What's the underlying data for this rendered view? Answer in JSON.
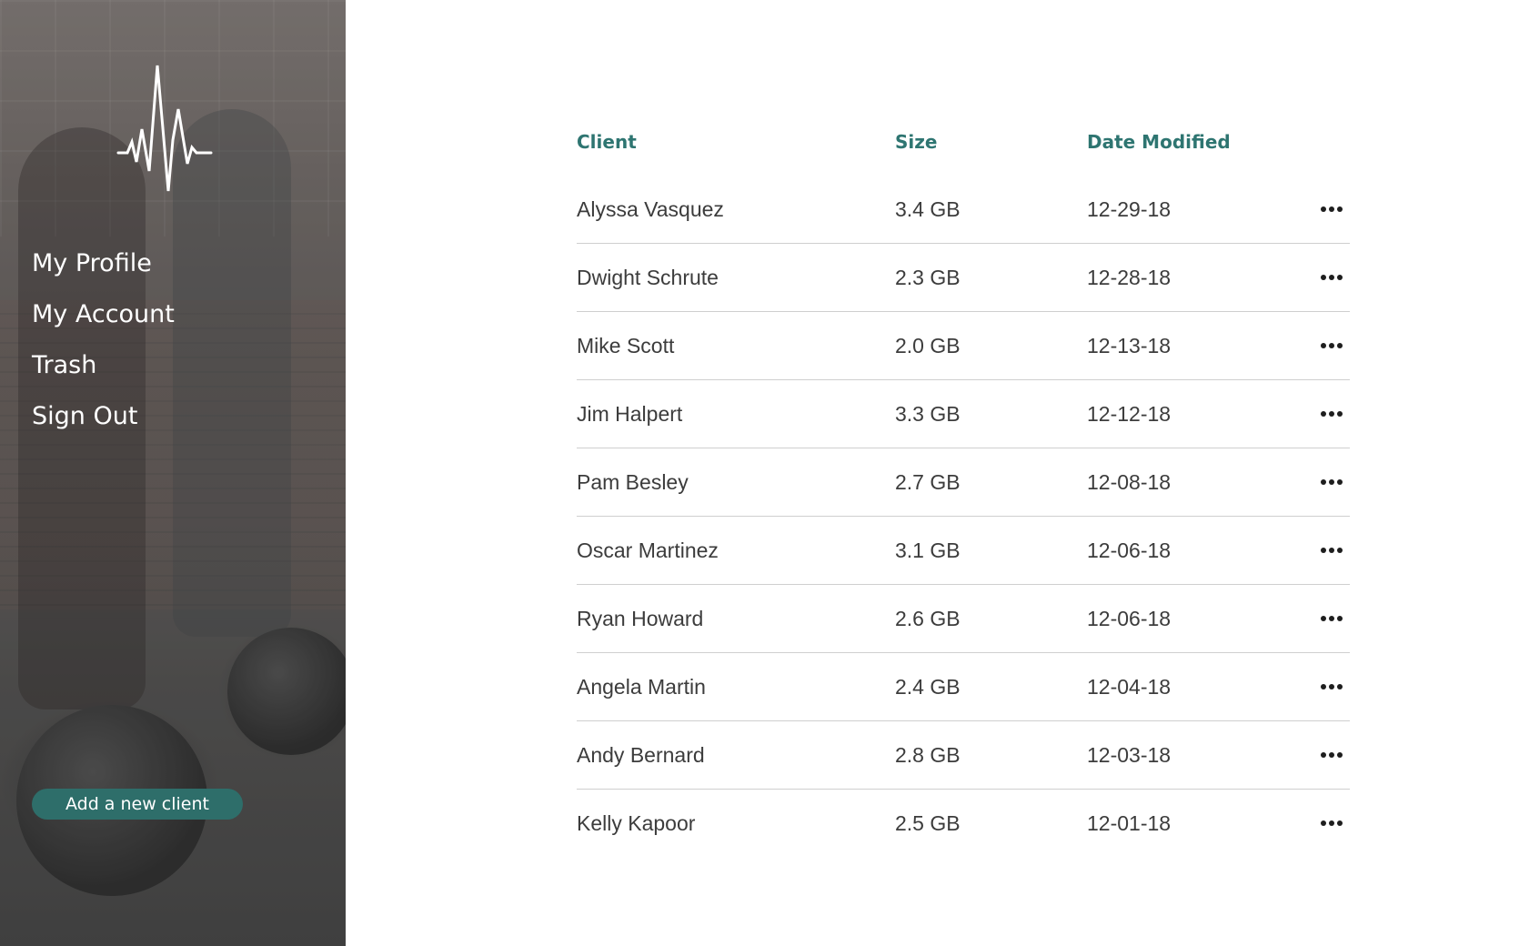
{
  "sidebar": {
    "logo_icon": "heartbeat-pulse-icon",
    "nav": [
      {
        "label": "My Profile"
      },
      {
        "label": "My Account"
      },
      {
        "label": "Trash"
      },
      {
        "label": "Sign Out"
      }
    ],
    "add_client_label": "Add a new client"
  },
  "table": {
    "headers": {
      "client": "Client",
      "size": "Size",
      "date": "Date Modified"
    },
    "row_menu_icon": "more-horizontal-icon",
    "rows": [
      {
        "client": "Alyssa Vasquez",
        "size": "3.4 GB",
        "date": "12-29-18"
      },
      {
        "client": "Dwight Schrute",
        "size": "2.3 GB",
        "date": "12-28-18"
      },
      {
        "client": "Mike Scott",
        "size": "2.0 GB",
        "date": "12-13-18"
      },
      {
        "client": "Jim Halpert",
        "size": "3.3 GB",
        "date": "12-12-18"
      },
      {
        "client": "Pam Besley",
        "size": "2.7 GB",
        "date": "12-08-18"
      },
      {
        "client": "Oscar Martinez",
        "size": "3.1 GB",
        "date": "12-06-18"
      },
      {
        "client": "Ryan Howard",
        "size": "2.6 GB",
        "date": "12-06-18"
      },
      {
        "client": "Angela Martin",
        "size": "2.4 GB",
        "date": "12-04-18"
      },
      {
        "client": "Andy Bernard",
        "size": "2.8 GB",
        "date": "12-03-18"
      },
      {
        "client": "Kelly Kapoor",
        "size": "2.5 GB",
        "date": "12-01-18"
      }
    ]
  },
  "colors": {
    "accent": "#2e7571",
    "button": "#2e6e6a",
    "text": "#3c3c3c"
  }
}
